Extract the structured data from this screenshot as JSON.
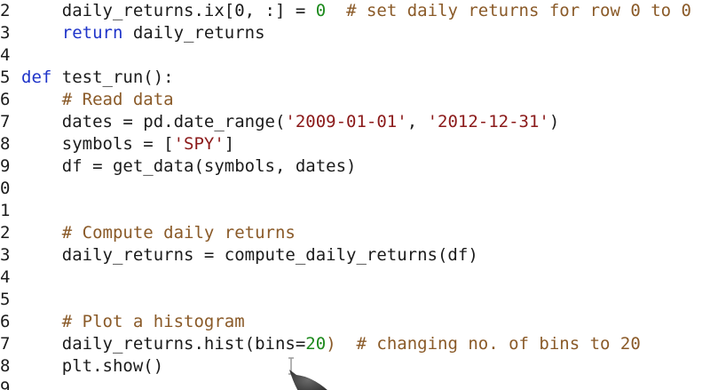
{
  "editor": {
    "lines": [
      {
        "num": "2",
        "segments": [
          {
            "t": "    daily_returns.ix[0, :] = ",
            "c": "plain"
          },
          {
            "t": "0",
            "c": "num"
          },
          {
            "t": "  # set daily returns for row 0 to 0",
            "c": "comment"
          }
        ]
      },
      {
        "num": "3",
        "segments": [
          {
            "t": "    ",
            "c": "plain"
          },
          {
            "t": "return",
            "c": "keyword"
          },
          {
            "t": " daily_returns",
            "c": "plain"
          }
        ]
      },
      {
        "num": "4",
        "segments": []
      },
      {
        "num": "5",
        "segments": [
          {
            "t": "def",
            "c": "keyword"
          },
          {
            "t": " test_run():",
            "c": "plain"
          }
        ]
      },
      {
        "num": "6",
        "segments": [
          {
            "t": "    # Read data",
            "c": "comment"
          }
        ]
      },
      {
        "num": "7",
        "segments": [
          {
            "t": "    dates = pd.date_range(",
            "c": "plain"
          },
          {
            "t": "'2009-01-01'",
            "c": "string"
          },
          {
            "t": ", ",
            "c": "plain"
          },
          {
            "t": "'2012-12-31'",
            "c": "string"
          },
          {
            "t": ")",
            "c": "plain"
          }
        ]
      },
      {
        "num": "8",
        "segments": [
          {
            "t": "    symbols = [",
            "c": "plain"
          },
          {
            "t": "'SPY'",
            "c": "string"
          },
          {
            "t": "]",
            "c": "plain"
          }
        ]
      },
      {
        "num": "9",
        "segments": [
          {
            "t": "    df = get_data(symbols, dates)",
            "c": "plain"
          }
        ]
      },
      {
        "num": "0",
        "segments": []
      },
      {
        "num": "1",
        "segments": []
      },
      {
        "num": "2",
        "segments": [
          {
            "t": "    # Compute daily returns",
            "c": "comment"
          }
        ]
      },
      {
        "num": "3",
        "segments": [
          {
            "t": "    daily_returns = compute_daily_returns(df)",
            "c": "plain"
          }
        ]
      },
      {
        "num": "4",
        "segments": []
      },
      {
        "num": "5",
        "segments": []
      },
      {
        "num": "6",
        "segments": [
          {
            "t": "    # Plot a histogram",
            "c": "comment"
          }
        ]
      },
      {
        "num": "7",
        "segments": [
          {
            "t": "    daily_returns.hist(bins=",
            "c": "plain"
          },
          {
            "t": "20",
            "c": "num"
          },
          {
            "t": ")  # changing no. of bins to 20",
            "c": "comment"
          }
        ]
      },
      {
        "num": "8",
        "segments": [
          {
            "t": "    plt.show()",
            "c": "plain"
          }
        ]
      },
      {
        "num": "9",
        "segments": []
      }
    ]
  },
  "colors": {
    "keyword": "#1f34c9",
    "comment": "#8a5a28",
    "string": "#8b1a1a",
    "number": "#1d8a1d",
    "plain": "#1b1b1b",
    "background": "#ffffff"
  },
  "icons": {
    "cursor": "i-beam-cursor-icon",
    "pen": "stylus-pen-icon"
  }
}
